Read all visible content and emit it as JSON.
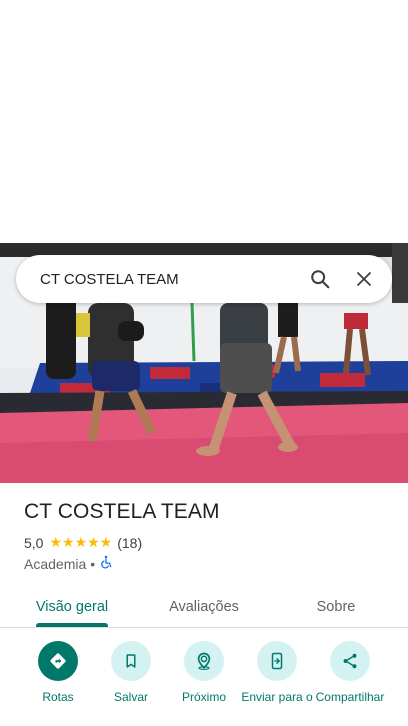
{
  "search": {
    "query": "CT COSTELA TEAM"
  },
  "place": {
    "name": "CT COSTELA TEAM",
    "rating": "5,0",
    "stars": "★★★★★",
    "review_count": "(18)",
    "category": "Academia",
    "separator": "•"
  },
  "tabs": [
    {
      "label": "Visão geral",
      "active": true
    },
    {
      "label": "Avaliações",
      "active": false
    },
    {
      "label": "Sobre",
      "active": false
    }
  ],
  "actions": [
    {
      "label": "Rotas",
      "icon": "directions-icon"
    },
    {
      "label": "Salvar",
      "icon": "bookmark-icon"
    },
    {
      "label": "Próximo",
      "icon": "nearby-icon"
    },
    {
      "label": "Enviar para o",
      "icon": "send-to-phone-icon"
    },
    {
      "label": "Compartilhar",
      "icon": "share-icon"
    }
  ],
  "colors": {
    "accent": "#00796b",
    "accent_light": "#d5f2f2",
    "star": "#fbbc04",
    "accessibility": "#1a73e8"
  }
}
